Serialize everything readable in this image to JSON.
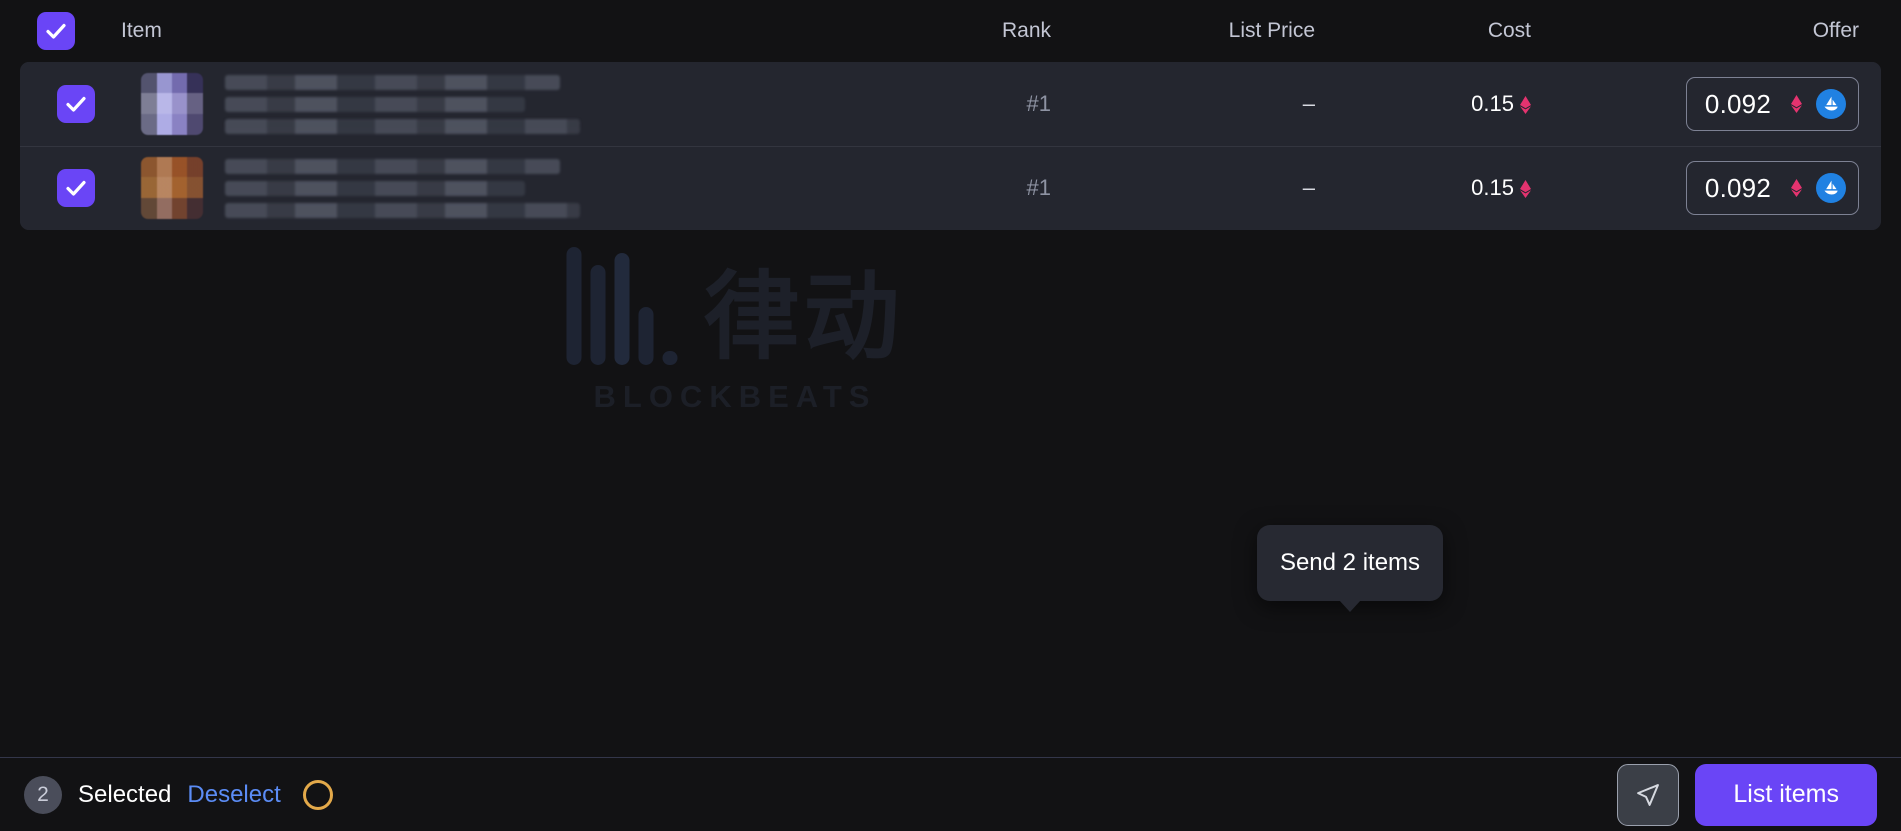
{
  "table": {
    "columns": {
      "item": "Item",
      "rank": "Rank",
      "list_price": "List Price",
      "cost": "Cost",
      "offer": "Offer"
    },
    "rows": [
      {
        "selected": true,
        "rank": "#1",
        "list_price": "–",
        "cost": "0.15",
        "cost_currency": "ETH",
        "offer_value": "0.092",
        "offer_currency": "ETH",
        "marketplace_icon": "opensea-icon"
      },
      {
        "selected": true,
        "rank": "#1",
        "list_price": "–",
        "cost": "0.15",
        "cost_currency": "ETH",
        "offer_value": "0.092",
        "offer_currency": "ETH",
        "marketplace_icon": "opensea-icon"
      }
    ],
    "select_all_checked": true
  },
  "watermark": {
    "cjk": "律动",
    "text": "BLOCKBEATS"
  },
  "tooltip": {
    "label": "Send 2 items"
  },
  "bottom_bar": {
    "count": "2",
    "selected_label": "Selected",
    "deselect_label": "Deselect",
    "ring_icon": "loading-ring-icon",
    "send_icon": "send-paper-plane-icon",
    "list_items_label": "List items"
  },
  "colors": {
    "accent_purple": "#6a45f6",
    "link_blue": "#5b8cf5",
    "eth_pink": "#e4336f",
    "opensea_blue": "#2081e2",
    "ring_amber": "#e3a94a",
    "row_bg": "#24262f",
    "page_bg": "#121214"
  }
}
